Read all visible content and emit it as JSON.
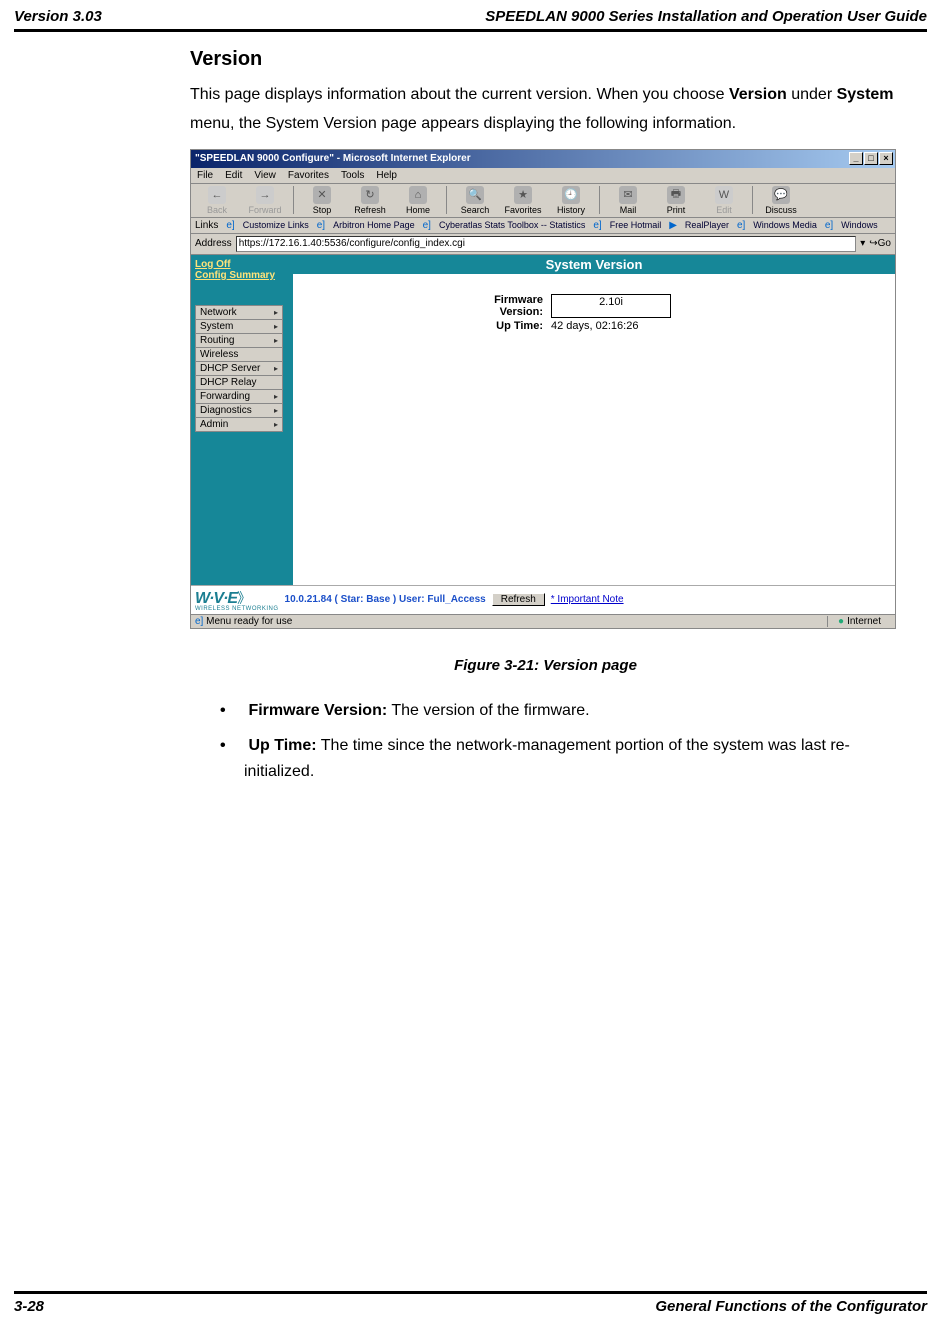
{
  "header": {
    "left": "Version 3.03",
    "right": "SPEEDLAN 9000 Series Installation and Operation User Guide"
  },
  "section": {
    "title": "Version",
    "intro_pre": "This page displays information about the current version. When you choose ",
    "intro_bold1": "Version",
    "intro_mid": " under ",
    "intro_bold2": "System",
    "intro_post": " menu, the System Version page appears displaying the following information."
  },
  "screenshot": {
    "window_title": "\"SPEEDLAN 9000 Configure\" - Microsoft Internet Explorer",
    "sysbtns": {
      "min": "_",
      "max": "□",
      "close": "×"
    },
    "menubar": [
      "File",
      "Edit",
      "View",
      "Favorites",
      "Tools",
      "Help"
    ],
    "toolbar": [
      {
        "label": "Back",
        "glyph": "←",
        "disabled": true
      },
      {
        "label": "Forward",
        "glyph": "→",
        "disabled": true
      },
      {
        "label": "Stop",
        "glyph": "✕",
        "disabled": false
      },
      {
        "label": "Refresh",
        "glyph": "↻",
        "disabled": false
      },
      {
        "label": "Home",
        "glyph": "⌂",
        "disabled": false
      },
      {
        "label": "Search",
        "glyph": "🔍",
        "disabled": false
      },
      {
        "label": "Favorites",
        "glyph": "★",
        "disabled": false
      },
      {
        "label": "History",
        "glyph": "🕘",
        "disabled": false
      },
      {
        "label": "Mail",
        "glyph": "✉",
        "disabled": false
      },
      {
        "label": "Print",
        "glyph": "🖶",
        "disabled": false
      },
      {
        "label": "Edit",
        "glyph": "W",
        "disabled": true
      },
      {
        "label": "Discuss",
        "glyph": "💬",
        "disabled": false
      }
    ],
    "linksbar_label": "Links",
    "linksbar": [
      "Customize Links",
      "Arbitron Home Page",
      "Cyberatlas Stats Toolbox -- Statistics",
      "Free Hotmail",
      "RealPlayer",
      "Windows Media",
      "Windows"
    ],
    "address_label": "Address",
    "address_value": "https://172.16.1.40:5536/configure/config_index.cgi",
    "go_label": "Go",
    "sidebar": {
      "logoff": "Log Off",
      "summary": "Config Summary",
      "items": [
        {
          "label": "Network",
          "arrow": true
        },
        {
          "label": "System",
          "arrow": true
        },
        {
          "label": "Routing",
          "arrow": true
        },
        {
          "label": "Wireless",
          "arrow": false
        },
        {
          "label": "DHCP Server",
          "arrow": true
        },
        {
          "label": "DHCP Relay",
          "arrow": false
        },
        {
          "label": "Forwarding",
          "arrow": true
        },
        {
          "label": "Diagnostics",
          "arrow": true
        },
        {
          "label": "Admin",
          "arrow": true
        }
      ]
    },
    "page_title": "System Version",
    "info": {
      "firmware_label": "Firmware Version:",
      "firmware_value": "2.10i",
      "uptime_label": "Up Time:",
      "uptime_value": "42 days, 02:16:26"
    },
    "footer": {
      "logo_main": "W·V·E",
      "logo_sub": "WIRELESS NETWORKING",
      "status_text": "10.0.21.84 ( Star: Base ) User: Full_Access",
      "refresh_btn": "Refresh",
      "important_note": "* Important Note"
    },
    "statusbar": {
      "left": "Menu ready for use",
      "zone": "Internet"
    }
  },
  "figure_caption": "Figure 3-21: Version page",
  "bullets": [
    {
      "term": "Firmware Version:",
      "desc": " The version of the firmware."
    },
    {
      "term": "Up Time:",
      "desc": " The time since the network-management portion of the system was last re-initialized."
    }
  ],
  "footer": {
    "left": "3-28",
    "right": "General Functions of the Configurator"
  }
}
